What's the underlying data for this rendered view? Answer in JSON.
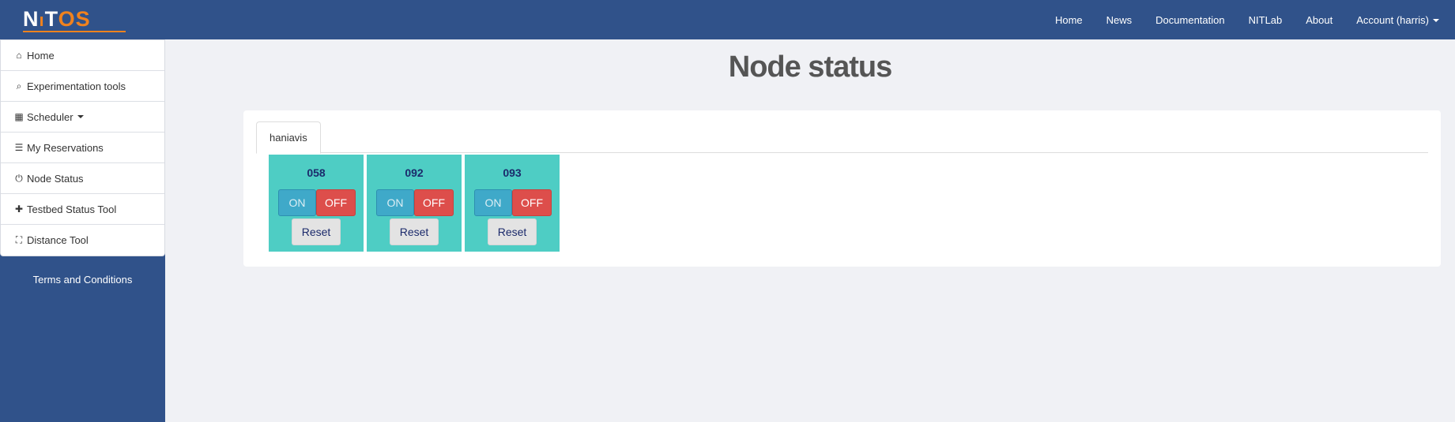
{
  "brand": {
    "logo_text_left": "N",
    "logo_text_right": "OS",
    "logo_tower_glyph": "ı",
    "logo_color": "#f0821e"
  },
  "topnav": {
    "items": [
      {
        "label": "Home"
      },
      {
        "label": "News"
      },
      {
        "label": "Documentation"
      },
      {
        "label": "NITLab"
      },
      {
        "label": "About"
      },
      {
        "label": "Account (harris)"
      }
    ]
  },
  "sidebar": {
    "items": [
      {
        "label": "Home",
        "icon": "home-icon",
        "glyph": "⌂"
      },
      {
        "label": "Experimentation tools",
        "icon": "search-icon",
        "glyph": "⌕"
      },
      {
        "label": "Scheduler",
        "icon": "calendar-icon",
        "glyph": "▦"
      },
      {
        "label": "My Reservations",
        "icon": "list-icon",
        "glyph": "☰"
      },
      {
        "label": "Node Status",
        "icon": "power-icon",
        "glyph": "⏻"
      },
      {
        "label": "Testbed Status Tool",
        "icon": "plus-icon",
        "glyph": "✚"
      },
      {
        "label": "Distance Tool",
        "icon": "fullscreen-icon",
        "glyph": "⛶"
      }
    ],
    "terms": "Terms and Conditions"
  },
  "main": {
    "title": "Node status",
    "tab": "haniavis",
    "nodes": [
      {
        "id": "058",
        "on_label": "ON",
        "off_label": "OFF",
        "reset_label": "Reset"
      },
      {
        "id": "092",
        "on_label": "ON",
        "off_label": "OFF",
        "reset_label": "Reset"
      },
      {
        "id": "093",
        "on_label": "ON",
        "off_label": "OFF",
        "reset_label": "Reset"
      }
    ]
  },
  "colors": {
    "navbar": "#30528a",
    "node_card": "#4ecdc4",
    "on_button": "#3fa9c9",
    "off_button": "#dd4e4b"
  }
}
